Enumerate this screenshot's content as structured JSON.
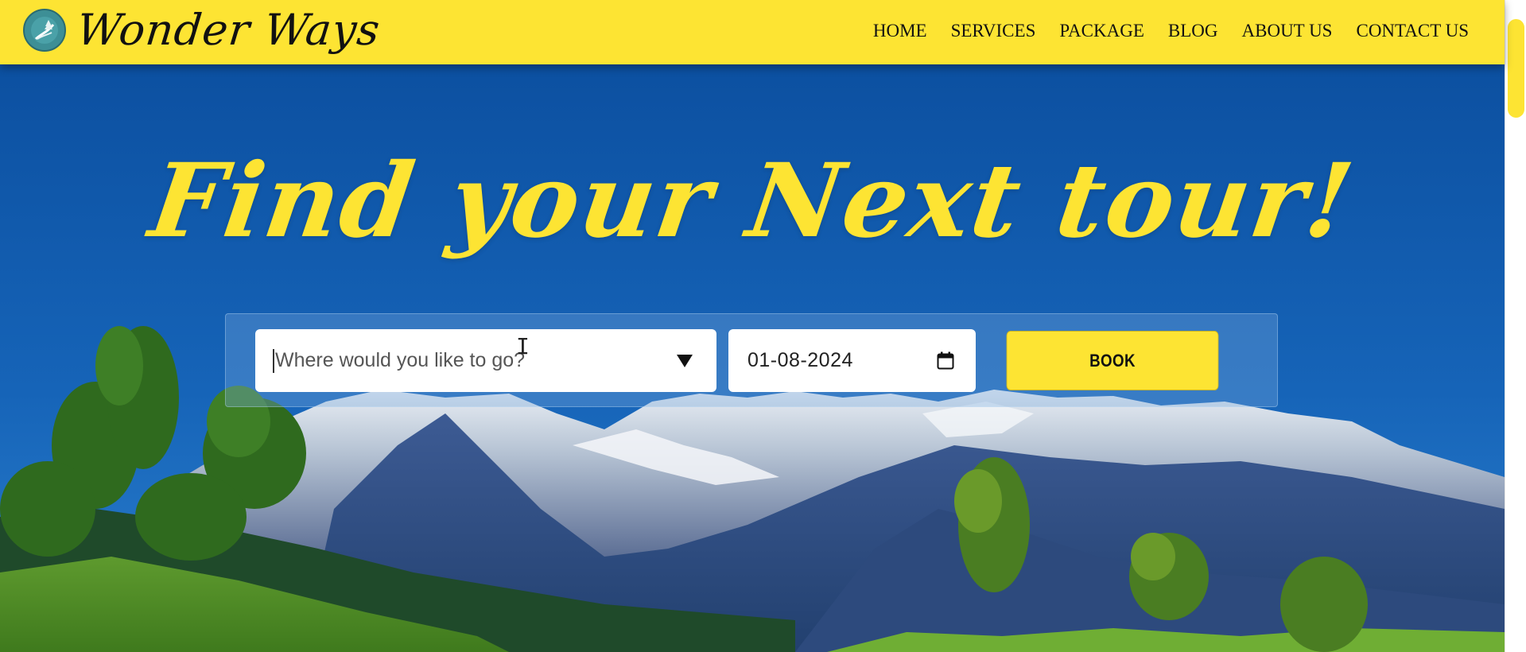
{
  "brand": {
    "name": "Wonder Ways",
    "logo_icon": "tree-road-logo-icon"
  },
  "nav": {
    "items": [
      {
        "label": "HOME"
      },
      {
        "label": "SERVICES"
      },
      {
        "label": "PACKAGE"
      },
      {
        "label": "BLOG"
      },
      {
        "label": "ABOUT US"
      },
      {
        "label": "CONTACT US"
      }
    ]
  },
  "hero": {
    "headline": "Find your Next tour!"
  },
  "search": {
    "destination_placeholder": "Where would you like to go?",
    "destination_icon": "chevron-down-icon",
    "date_value": "01-08-2024",
    "date_icon": "calendar-icon",
    "book_label": "BOOK"
  },
  "colors": {
    "accent_yellow": "#fde433",
    "hero_blue": "#0e5aae"
  }
}
